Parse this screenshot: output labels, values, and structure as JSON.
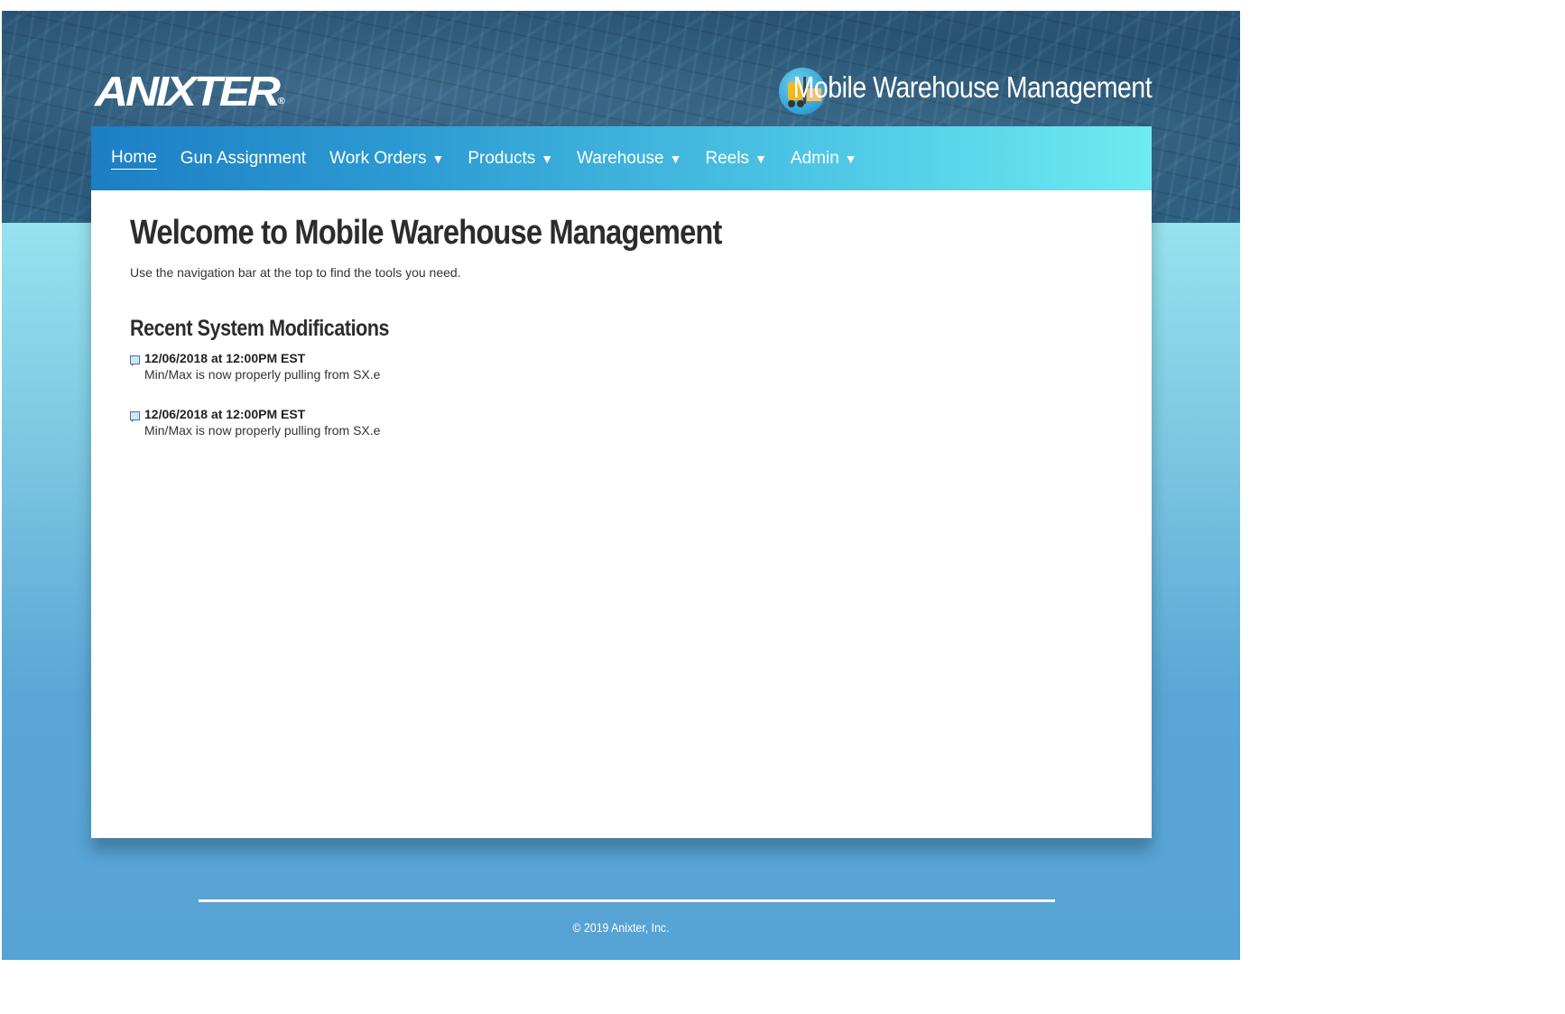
{
  "header": {
    "logo_text": "ANIXTER",
    "logo_tm": "®",
    "app_title": "Mobile Warehouse Management",
    "app_icon": "forklift-icon"
  },
  "nav": {
    "items": [
      {
        "label": "Home",
        "dropdown": false,
        "active": true
      },
      {
        "label": "Gun Assignment",
        "dropdown": false
      },
      {
        "label": "Work Orders",
        "dropdown": true
      },
      {
        "label": "Products",
        "dropdown": true
      },
      {
        "label": "Warehouse",
        "dropdown": true
      },
      {
        "label": "Reels",
        "dropdown": true
      },
      {
        "label": "Admin",
        "dropdown": true
      }
    ],
    "caret": "▼"
  },
  "main": {
    "title": "Welcome to Mobile Warehouse Management",
    "subtitle": "Use the navigation bar at the top to find the tools you need.",
    "mods_title": "Recent System Modifications",
    "modifications": [
      {
        "date": "12/06/2018 at 12:00PM EST",
        "text": "Min/Max is now properly pulling from SX.e"
      },
      {
        "date": "12/06/2018 at 12:00PM EST",
        "text": "Min/Max is now properly pulling from SX.e"
      }
    ]
  },
  "footer": {
    "copyright": "© 2019 Anixter, Inc."
  },
  "colors": {
    "header_dark": "#2a5475",
    "nav_start": "#1c7fc4",
    "nav_end": "#6feaf0",
    "bg_light": "#97e2ee",
    "bg_bottom": "#56a3d5"
  }
}
